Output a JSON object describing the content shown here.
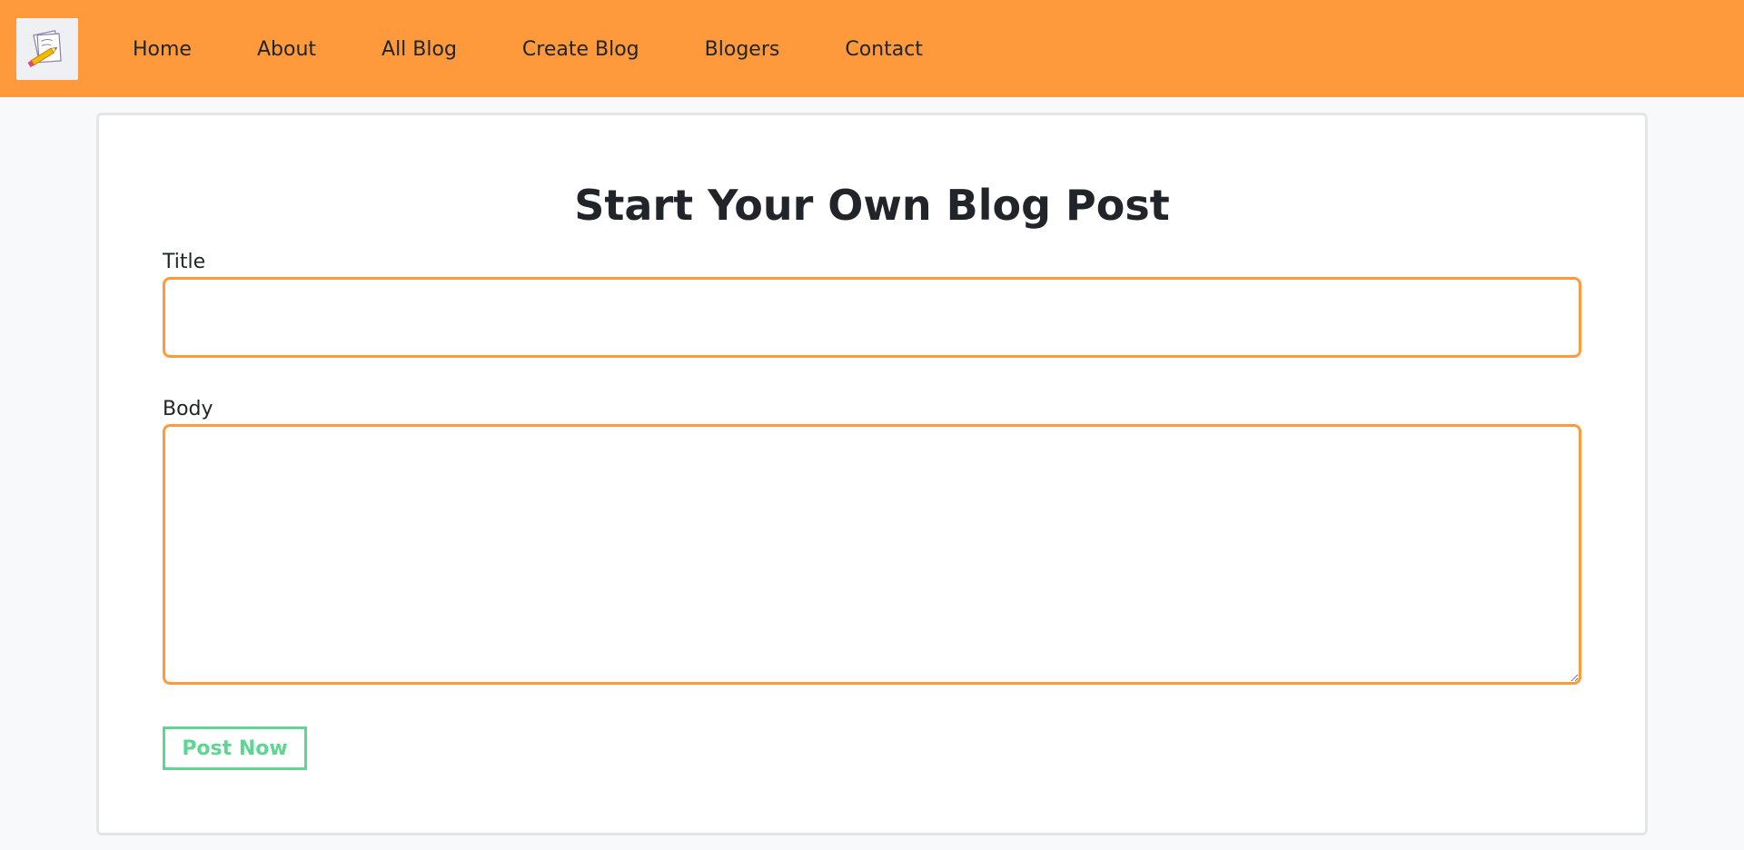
{
  "nav": {
    "logo_icon": "blog-logo-icon",
    "links": [
      {
        "label": "Home"
      },
      {
        "label": "About"
      },
      {
        "label": "All Blog"
      },
      {
        "label": "Create Blog"
      },
      {
        "label": "Blogers"
      },
      {
        "label": "Contact"
      }
    ]
  },
  "form": {
    "heading": "Start Your Own Blog Post",
    "title_label": "Title",
    "title_value": "",
    "body_label": "Body",
    "body_value": "",
    "submit_label": "Post Now"
  },
  "colors": {
    "navbar": "#ff9a3c",
    "accent": "#ff9a3c",
    "button": "#5cd691",
    "page_bg": "#f8f9fa"
  }
}
